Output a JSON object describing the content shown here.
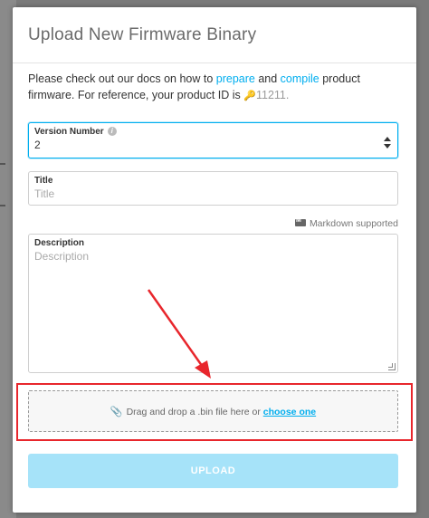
{
  "modal": {
    "title": "Upload New Firmware Binary",
    "intro": {
      "text_before": "Please check out our docs on how to ",
      "link_prepare": "prepare",
      "text_and": " and ",
      "link_compile": "compile",
      "text_after": " product firmware. For reference, your product ID is ",
      "product_id": "11211."
    }
  },
  "form": {
    "version": {
      "label": "Version Number",
      "value": "2"
    },
    "title": {
      "label": "Title",
      "placeholder": "Title"
    },
    "markdown_note": "Markdown supported",
    "description": {
      "label": "Description",
      "placeholder": "Description"
    },
    "dropzone": {
      "text": "Drag and drop a .bin file here or ",
      "link": "choose one"
    },
    "upload_label": "UPLOAD"
  },
  "annotation": {
    "highlight_color": "#e8262c",
    "arrow_color": "#e8262c"
  },
  "colors": {
    "accent": "#00aeef",
    "upload_disabled": "#a6e3f9"
  },
  "icons": {
    "product_id": "key-icon",
    "version_info": "info-icon",
    "markdown": "markdown-icon",
    "dropzone": "paperclip-icon"
  }
}
